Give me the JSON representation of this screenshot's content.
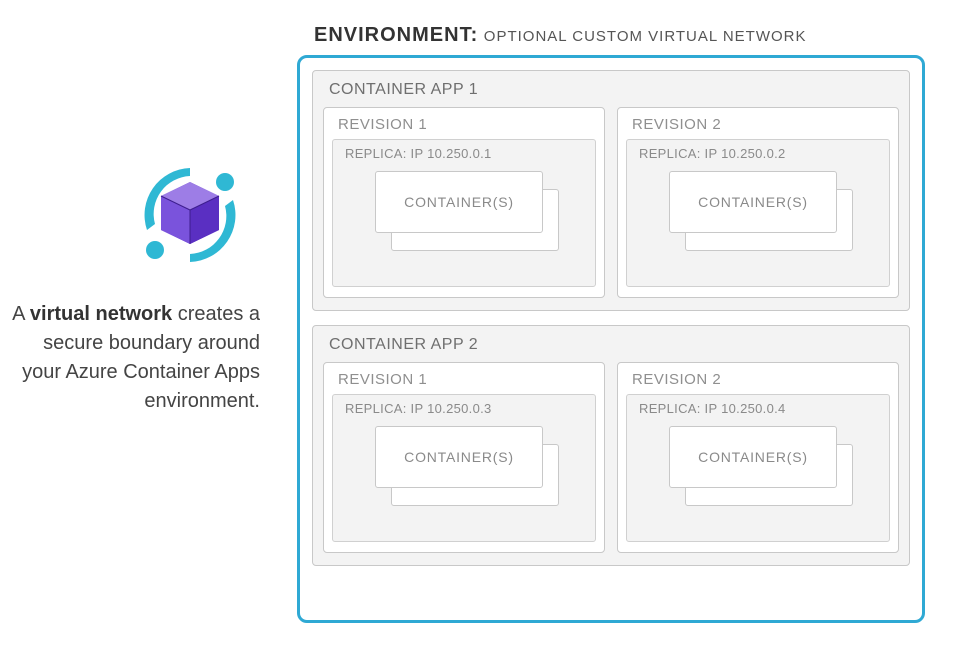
{
  "description": {
    "prefix_a": "A ",
    "bold": "virtual network",
    "rest": " creates a secure boundary around your Azure Container Apps environment."
  },
  "environment": {
    "label": "ENVIRONMENT:",
    "subtitle": "OPTIONAL CUSTOM VIRTUAL NETWORK",
    "apps": [
      {
        "title": "CONTAINER APP 1",
        "revisions": [
          {
            "title": "REVISION 1",
            "replica": "REPLICA: IP 10.250.0.1",
            "containers": "CONTAINER(S)"
          },
          {
            "title": "REVISION 2",
            "replica": "REPLICA: IP 10.250.0.2",
            "containers": "CONTAINER(S)"
          }
        ]
      },
      {
        "title": "CONTAINER APP 2",
        "revisions": [
          {
            "title": "REVISION 1",
            "replica": "REPLICA: IP 10.250.0.3",
            "containers": "CONTAINER(S)"
          },
          {
            "title": "REVISION 2",
            "replica": "REPLICA: IP 10.250.0.4",
            "containers": "CONTAINER(S)"
          }
        ]
      }
    ]
  }
}
